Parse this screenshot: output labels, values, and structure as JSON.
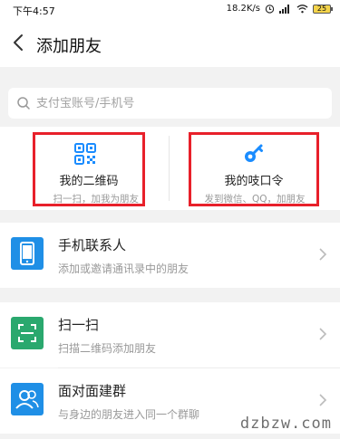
{
  "status_bar": {
    "time": "下午4:57",
    "net_speed": "18.2K/s",
    "battery": "25"
  },
  "header": {
    "title": "添加朋友",
    "back_icon": "chevron-left-icon"
  },
  "search": {
    "placeholder": "支付宝账号/手机号",
    "icon": "search-icon"
  },
  "quick_actions": [
    {
      "title": "我的二维码",
      "subtitle": "扫一扫，加我为朋友",
      "icon": "qr-code-icon",
      "color": "#1a8cff"
    },
    {
      "title": "我的吱口令",
      "subtitle": "发到微信、QQ，加朋友",
      "icon": "key-icon",
      "color": "#1a8cff"
    }
  ],
  "highlight_color": "#e8202a",
  "menu": [
    {
      "title": "手机联系人",
      "subtitle": "添加或邀请通讯录中的朋友",
      "icon": "phone-icon",
      "color": "#1f8fe6"
    },
    {
      "title": "扫一扫",
      "subtitle": "扫描二维码添加朋友",
      "icon": "scan-icon",
      "color": "#2aa86e"
    },
    {
      "title": "面对面建群",
      "subtitle": "与身边的朋友进入同一个群聊",
      "icon": "group-icon",
      "color": "#1f8fe6"
    }
  ],
  "watermark": "dzbzw.com"
}
